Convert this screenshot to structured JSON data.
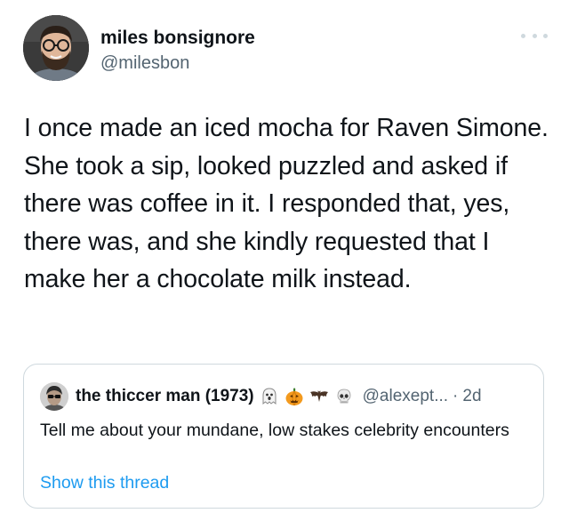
{
  "tweet": {
    "author": {
      "name": "miles bonsignore",
      "handle": "@milesbon"
    },
    "text": "I once made an iced mocha for Raven Simone. She took a sip, looked puzzled and asked if there was coffee in it. I responded that, yes, there was, and she kindly requested that I make her a chocolate milk instead.",
    "more_icon": "more-horizontal-icon",
    "quoted_tweet": {
      "author": {
        "name": "the thiccer man (1973)",
        "emojis": [
          "ghost-icon",
          "pumpkin-icon",
          "bat-icon",
          "skull-icon"
        ],
        "handle": "@alexept...",
        "separator": "·",
        "time": "2d"
      },
      "text": "Tell me about your mundane, low stakes celebrity encounters",
      "show_thread_label": "Show this thread"
    }
  },
  "colors": {
    "text_primary": "#0f1419",
    "text_secondary": "#536471",
    "link": "#1d9bf0",
    "border": "#cfd9de"
  }
}
